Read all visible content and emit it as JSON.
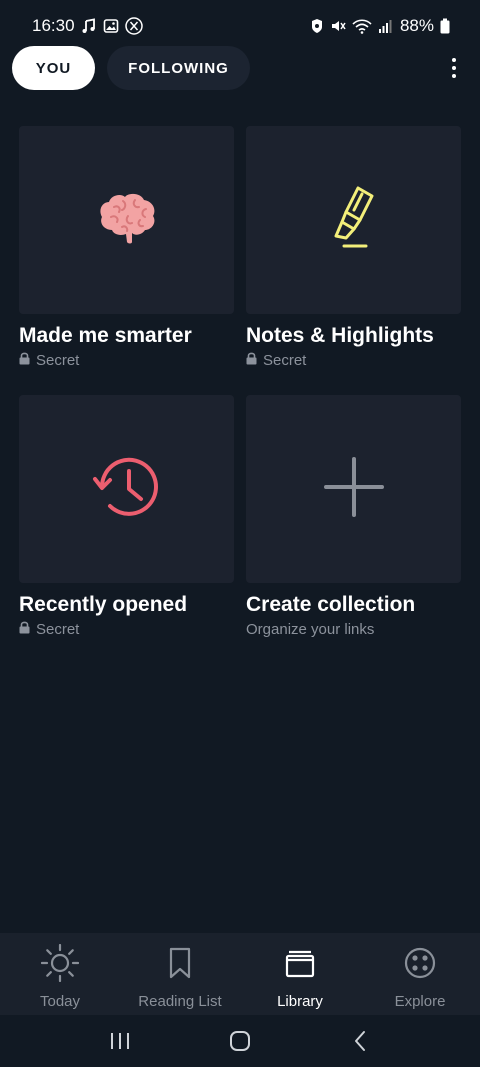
{
  "status_bar": {
    "time": "16:30",
    "battery": "88%",
    "icons": [
      "music-note-icon",
      "gallery-icon",
      "x-logo-icon",
      "vpn-icon",
      "mute-icon",
      "wifi-icon",
      "signal-icon",
      "battery-icon"
    ]
  },
  "tabs": {
    "you": "YOU",
    "following": "FOLLOWING",
    "active": "you"
  },
  "collections": [
    {
      "title": "Made me smarter",
      "subtitle": "Secret",
      "icon": "brain-icon",
      "locked": true
    },
    {
      "title": "Notes & Highlights",
      "subtitle": "Secret",
      "icon": "highlighter-icon",
      "locked": true
    },
    {
      "title": "Recently opened",
      "subtitle": "Secret",
      "icon": "history-icon",
      "locked": true
    },
    {
      "title": "Create collection",
      "subtitle": "Organize your links",
      "icon": "plus-icon",
      "locked": false
    }
  ],
  "colors": {
    "background": "#111923",
    "card": "#1c222e",
    "brain": "#f2a3a3",
    "highlighter": "#f3ef7a",
    "history": "#ec5e6f",
    "plus": "#8a8f98",
    "secondary_text": "#8c929c"
  },
  "bottom_nav": [
    {
      "label": "Today",
      "icon": "sun-icon",
      "active": false
    },
    {
      "label": "Reading List",
      "icon": "bookmark-icon",
      "active": false
    },
    {
      "label": "Library",
      "icon": "library-icon",
      "active": true
    },
    {
      "label": "Explore",
      "icon": "explore-icon",
      "active": false
    }
  ]
}
